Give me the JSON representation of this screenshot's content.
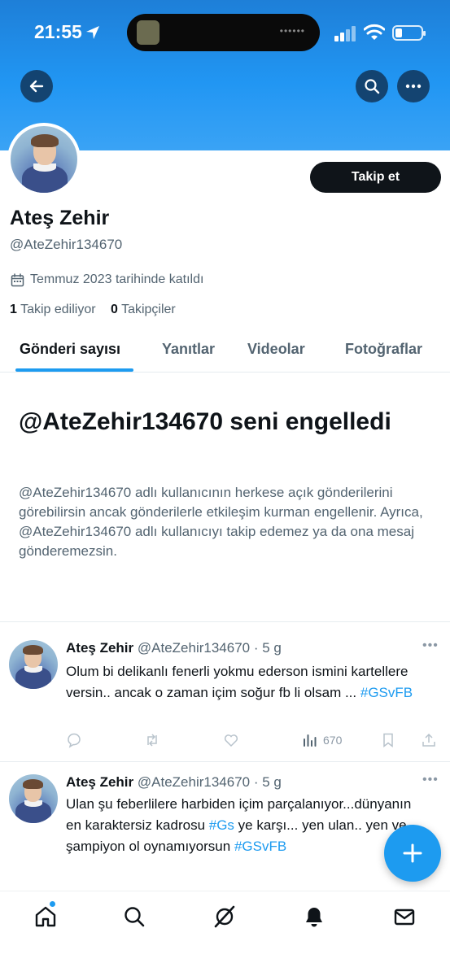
{
  "status_bar": {
    "time": "21:55"
  },
  "profile": {
    "name": "Ateş Zehir",
    "handle": "@AteZehir134670",
    "follow_label": "Takip et",
    "joined": "Temmuz 2023 tarihinde katıldı",
    "following_count": "1",
    "following_label": "Takip ediliyor",
    "followers_count": "0",
    "followers_label": "Takipçiler"
  },
  "tabs": [
    {
      "label": "Gönderi sayısı",
      "active": true
    },
    {
      "label": "Yanıtlar",
      "active": false
    },
    {
      "label": "Videolar",
      "active": false
    },
    {
      "label": "Fotoğraflar",
      "active": false
    }
  ],
  "blocked": {
    "title": "@AteZehir134670 seni engelledi",
    "text": "@AteZehir134670 adlı kullanıcının herkese açık gönderilerini görebilirsin ancak gönderilerle etkileşim kurman engellenir. Ayrıca, @AteZehir134670 adlı kullanıcıyı takip edemez ya da ona mesaj gönderemezsin."
  },
  "tweets": [
    {
      "name": "Ateş Zehir",
      "meta": "@AteZehir134670 · 5 g",
      "text": "Olum bi delikanlı fenerli yokmu ederson ismini kartellere versin.. ancak o zaman içim soğur fb li olsam ... ",
      "hashtag": "#GSvFB",
      "views": "670"
    },
    {
      "name": "Ateş Zehir",
      "meta": "@AteZehir134670 · 5 g",
      "text_part1": "Ulan şu feberlilere harbiden içim parçalanıyor...dünyanın en karaktersiz kadrosu ",
      "hashtag1": "#Gs",
      "text_part2": " ye karşı... yen ulan.. yen ve şampiyon ol oynamıyorsun ",
      "hashtag2": "#GSvFB"
    }
  ],
  "colors": {
    "accent": "#1d9bf0",
    "header_blue": "#2196f3",
    "text_primary": "#0f1419",
    "text_secondary": "#536471"
  },
  "icons": {
    "back": "arrow-left-icon",
    "search": "search-icon",
    "more": "more-icon",
    "calendar": "calendar-icon",
    "compose": "plus-icon",
    "nav": [
      "home-icon",
      "search-icon",
      "grok-icon",
      "bell-icon",
      "mail-icon"
    ]
  }
}
